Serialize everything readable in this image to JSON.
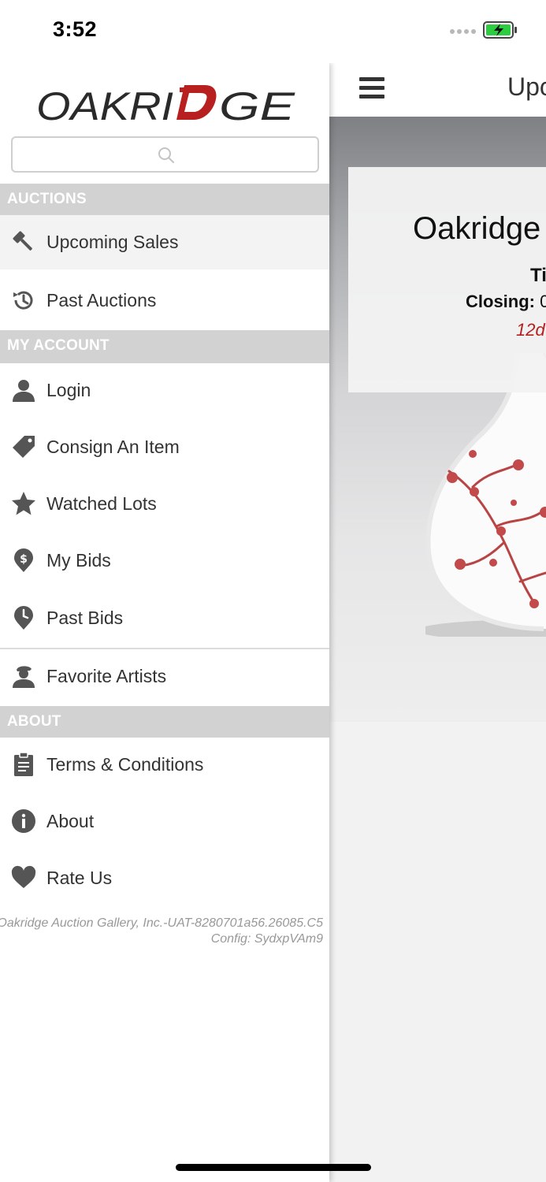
{
  "status_bar": {
    "time": "3:52"
  },
  "brand": {
    "logo_text": "OAKRIDGE",
    "accent": "#b8201f"
  },
  "search": {
    "placeholder": ""
  },
  "sections": {
    "auctions": "AUCTIONS",
    "my_account": "MY ACCOUNT",
    "about": "ABOUT"
  },
  "menu": {
    "upcoming_sales": "Upcoming Sales",
    "past_auctions": "Past Auctions",
    "login": "Login",
    "consign": "Consign An Item",
    "watched_lots": "Watched Lots",
    "my_bids": "My Bids",
    "past_bids": "Past Bids",
    "favorite_artists": "Favorite Artists",
    "terms": "Terms & Conditions",
    "about": "About",
    "rate_us": "Rate Us"
  },
  "footer": {
    "version_line1": "Oakridge Auction Gallery, Inc.-UAT-8280701a56.26085.C5",
    "version_line2": "Config: SydxpVAm9"
  },
  "main": {
    "header_title": "Upc",
    "card_title": "Oakridge",
    "card_line1": "Ti",
    "card_closing_label": "Closing:",
    "card_closing_value": "0",
    "card_countdown": "12d"
  },
  "colors": {
    "section_header_bg": "#d2d2d2",
    "active_item_bg": "#f3f3f3",
    "countdown": "#b3201e",
    "battery": "#2ecc40"
  }
}
